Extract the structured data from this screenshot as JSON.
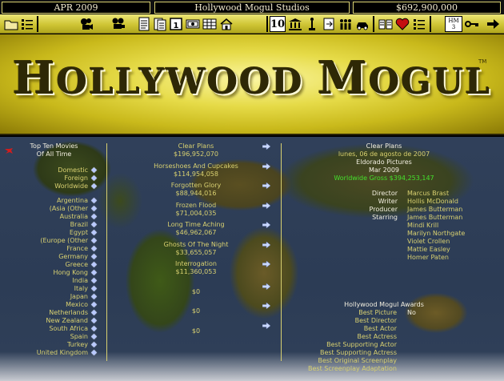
{
  "status": {
    "date": "APR 2009",
    "studio": "Hollywood Mogul Studios",
    "money": "$692,900,000"
  },
  "toolbar": {
    "hm_badge_top": "HM",
    "hm_badge_num": "3",
    "ten_label": "10",
    "icons": [
      "folder-icon",
      "checklist-icon",
      "film-camera-icon",
      "movie-camera-icon",
      "script-icon",
      "document-icon",
      "calendar-icon",
      "money-icon",
      "spreadsheet-icon",
      "house-icon",
      "ten-icon",
      "bank-icon",
      "trophy-icon",
      "exit-door-icon",
      "crowd-icon",
      "car-icon",
      "book-icon",
      "heart-icon",
      "list-icon",
      "hm3-icon",
      "key-icon",
      "next-arrow-icon"
    ]
  },
  "banner": {
    "title_h": "H",
    "title_rest1": "OLLYWOOD ",
    "title_m": "M",
    "title_rest2": "OGUL",
    "tm": "TM"
  },
  "left": {
    "header_line1": "Top Ten Movies",
    "header_line2": "Of All Time",
    "items": [
      "Domestic",
      "Foreign",
      "Worldwide",
      "Argentina",
      "(Asia (Other",
      "Australia",
      "Brazil",
      "Egypt",
      "(Europe (Other",
      "France",
      "Germany",
      "Greece",
      "Hong Kong",
      "India",
      "Italy",
      "Japan",
      "Mexico",
      "Netherlands",
      "New Zealand",
      "South Africa",
      "Spain",
      "Turkey",
      "United Kingdom"
    ]
  },
  "movies": [
    {
      "title": "Clear Plans",
      "gross": "$196,952,070"
    },
    {
      "title": "Horseshoes And Cupcakes",
      "gross": "$114,954,058"
    },
    {
      "title": "Forgotten Glory",
      "gross": "$88,944,016"
    },
    {
      "title": "Frozen Flood",
      "gross": "$71,004,035"
    },
    {
      "title": "Long Time Aching",
      "gross": "$46,962,067"
    },
    {
      "title": "Ghosts Of The Night",
      "gross": "$33,655,057"
    },
    {
      "title": "Interrogation",
      "gross": "$11,360,053"
    },
    {
      "title": "",
      "gross": "$0"
    },
    {
      "title": "",
      "gross": "$0"
    },
    {
      "title": "",
      "gross": "$0"
    }
  ],
  "detail": {
    "title": "Clear Plans",
    "date": "lunes, 06 de agosto de 2007",
    "studio": "Eldorado Pictures",
    "release": "Mar 2009",
    "worldwide": "Worldwide Gross $394,253,147",
    "credits": [
      {
        "role": "Director",
        "name": "Marcus Brast"
      },
      {
        "role": "Writer",
        "name": "Hollis McDonald"
      },
      {
        "role": "Producer",
        "name": "James Butterman"
      },
      {
        "role": "Starring",
        "name": "James Butterman"
      },
      {
        "role": "",
        "name": "Mindi Krill"
      },
      {
        "role": "",
        "name": "Marilyn Northgate"
      },
      {
        "role": "",
        "name": "Violet Crollen"
      },
      {
        "role": "",
        "name": "Mattie Easley"
      },
      {
        "role": "",
        "name": "Homer Paten"
      }
    ],
    "awards_title": "Hollywood Mogul Awards",
    "awards": [
      {
        "name": "Best Picture",
        "value": "No"
      },
      {
        "name": "Best Director",
        "value": ""
      },
      {
        "name": "Best Actor",
        "value": ""
      },
      {
        "name": "Best Actress",
        "value": ""
      },
      {
        "name": "Best Supporting Actor",
        "value": ""
      },
      {
        "name": "Best Supporting Actress",
        "value": ""
      },
      {
        "name": "Best Original Screenplay",
        "value": ""
      },
      {
        "name": "Best Screenplay Adaptation",
        "value": ""
      }
    ]
  },
  "colors": {
    "accent_gold": "#d8d070",
    "text_white": "#f3efe0",
    "gross_green": "#44e02c"
  }
}
